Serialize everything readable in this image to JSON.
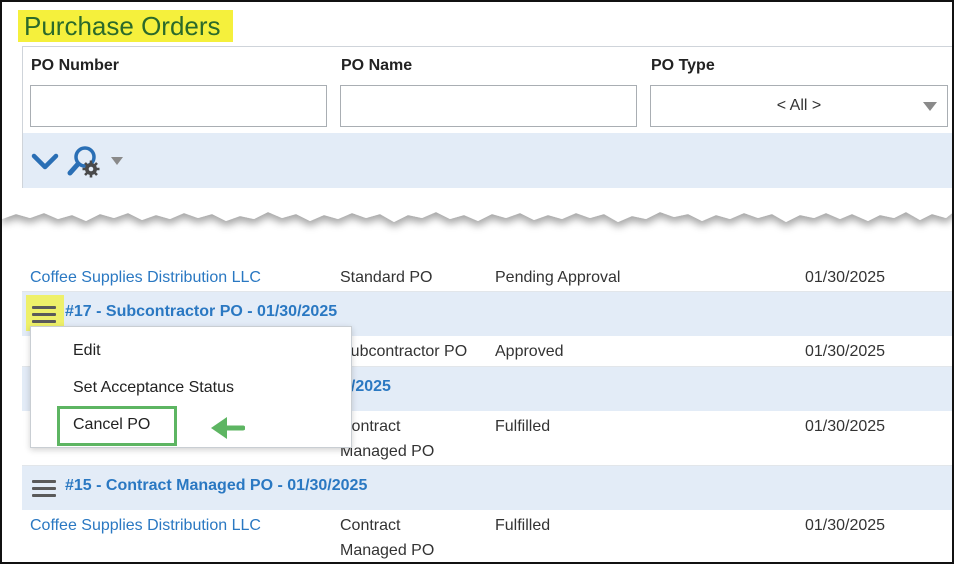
{
  "page": {
    "title": "Purchase Orders"
  },
  "filters": {
    "po_number": {
      "label": "PO Number",
      "value": "",
      "placeholder": ""
    },
    "po_name": {
      "label": "PO Name",
      "value": "",
      "placeholder": ""
    },
    "po_type": {
      "label": "PO Type",
      "selected": "< All >"
    }
  },
  "toolbar": {
    "icons": [
      "chevron-down-icon",
      "search-settings-icon",
      "dropdown-caret-icon"
    ]
  },
  "rows": [
    {
      "vendor": "Coffee Supplies Distribution LLC",
      "type": "Standard PO",
      "status": "Pending Approval",
      "date": "01/30/2025"
    },
    {
      "vendor": "",
      "type": "Subcontractor PO",
      "status": "Approved",
      "date": "01/30/2025"
    },
    {
      "vendor": "",
      "type_line1": "Contract",
      "type_line2": "Managed PO",
      "status": "Fulfilled",
      "date": "01/30/2025"
    },
    {
      "vendor": "Coffee Supplies Distribution LLC",
      "type_line1": "Contract",
      "type_line2": "Managed PO",
      "status": "Fulfilled",
      "date": "01/30/2025"
    }
  ],
  "groups": [
    {
      "title": "#17 - Subcontractor PO - 01/30/2025"
    },
    {
      "title": "0/2025"
    },
    {
      "title": "#15 - Contract Managed PO - 01/30/2025"
    }
  ],
  "context_menu": {
    "items": [
      "Edit",
      "Set Acceptance Status",
      "Cancel PO"
    ]
  },
  "colors": {
    "highlight": "#f5f03c",
    "title_green": "#2b6a2b",
    "link_blue": "#2a78c2",
    "callout_green": "#5db562",
    "band": "#e3ecf7"
  }
}
